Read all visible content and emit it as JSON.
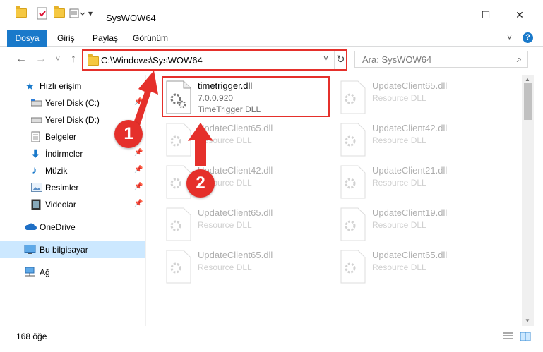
{
  "window": {
    "title": "SysWOW64",
    "minimize_glyph": "—",
    "maximize_glyph": "☐",
    "close_glyph": "✕"
  },
  "ribbon": {
    "tabs": [
      "Dosya",
      "Giriş",
      "Paylaş",
      "Görünüm"
    ],
    "help_glyph": "?",
    "collapse_glyph": "˅"
  },
  "nav": {
    "back_glyph": "←",
    "forward_glyph": "→",
    "recent_glyph": "˅",
    "up_glyph": "↑",
    "address": "C:\\Windows\\SysWOW64",
    "dropdown_glyph": "˅",
    "refresh_glyph": "↻",
    "search_placeholder": "Ara: SysWOW64",
    "search_glyph": "⌕"
  },
  "sidebar": {
    "items": [
      {
        "label": "Hızlı erişim",
        "icon": "star-icon",
        "pinned": false
      },
      {
        "label": "Yerel Disk (C:)",
        "icon": "drive-icon",
        "pinned": true
      },
      {
        "label": "Yerel Disk (D:)",
        "icon": "drive-icon",
        "pinned": true
      },
      {
        "label": "Belgeler",
        "icon": "documents-icon",
        "pinned": true
      },
      {
        "label": "İndirmeler",
        "icon": "download-icon",
        "pinned": true
      },
      {
        "label": "Müzik",
        "icon": "music-icon",
        "pinned": true
      },
      {
        "label": "Resimler",
        "icon": "pictures-icon",
        "pinned": true
      },
      {
        "label": "Videolar",
        "icon": "video-icon",
        "pinned": true
      },
      {
        "label": "OneDrive",
        "icon": "cloud-icon",
        "pinned": false
      },
      {
        "label": "Bu bilgisayar",
        "icon": "computer-icon",
        "pinned": false,
        "selected": true
      },
      {
        "label": "Ağ",
        "icon": "network-icon",
        "pinned": false
      }
    ]
  },
  "files": {
    "highlighted": {
      "name": "timetrigger.dll",
      "version": "7.0.0.920",
      "description": "TimeTrigger DLL"
    },
    "faded": [
      {
        "name": "UpdateClient65.dll",
        "description": "Resource DLL"
      },
      {
        "name": "UpdateClient65.dll",
        "description": "Resource DLL"
      },
      {
        "name": "UpdateClient42.dll",
        "description": "Resource DLL"
      },
      {
        "name": "UpdateClient42.dll",
        "description": "Resource DLL"
      },
      {
        "name": "UpdateClient21.dll",
        "description": "Resource DLL"
      },
      {
        "name": "UpdateClient65.dll",
        "description": "Resource DLL"
      },
      {
        "name": "UpdateClient19.dll",
        "description": "Resource DLL"
      },
      {
        "name": "UpdateClient65.dll",
        "description": "Resource DLL"
      },
      {
        "name": "UpdateClient65.dll",
        "description": "Resource DLL"
      }
    ]
  },
  "status": {
    "count": "168 öğe"
  },
  "annotations": {
    "step1": "1",
    "step2": "2",
    "color": "#e5302b"
  },
  "colors": {
    "accent": "#1979ca",
    "selected_bg": "#cce8ff",
    "annotation": "#e5302b"
  }
}
